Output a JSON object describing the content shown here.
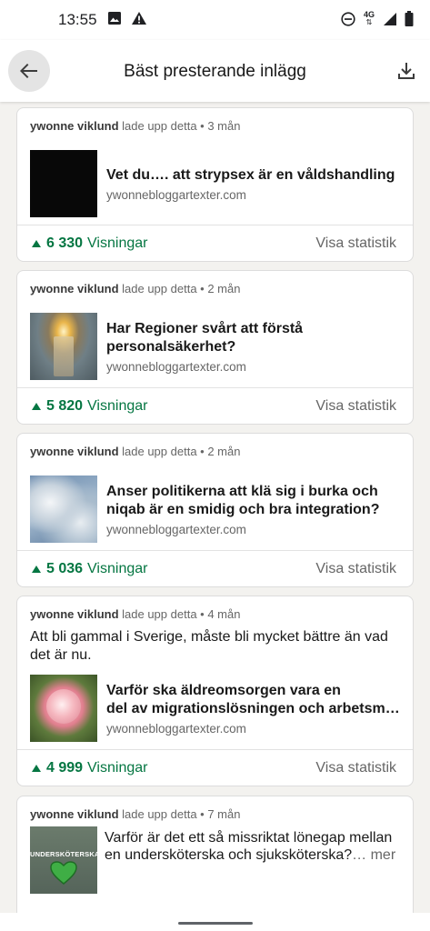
{
  "status_bar": {
    "time": "13:55",
    "network_label": "4G",
    "icons": [
      "image-icon",
      "warning-icon",
      "do-not-disturb-icon",
      "signal-icon",
      "battery-icon"
    ]
  },
  "header": {
    "title": "Bäst presterande inlägg",
    "back_icon": "arrow-back-icon",
    "download_icon": "download-icon"
  },
  "posts": [
    {
      "author": "ywonne viklund",
      "meta": "lade upp detta • 3 mån",
      "thumbnail": "black-thumbnail",
      "link_title": "Vet du…. att strypsex är en våldshandling",
      "link_domain": "ywonnebloggartexter.com",
      "views_count": "6 330",
      "views_label": "Visningar",
      "stats_label": "Visa statistik"
    },
    {
      "author": "ywonne viklund",
      "meta": "lade upp detta • 2 mån",
      "thumbnail": "candle-thumbnail",
      "link_title": "Har Regioner svårt att förstå personalsäkerhet?",
      "link_domain": "ywonnebloggartexter.com",
      "views_count": "5 820",
      "views_label": "Visningar",
      "stats_label": "Visa statistik"
    },
    {
      "author": "ywonne viklund",
      "meta": "lade upp detta • 2 mån",
      "thumbnail": "sky-thumbnail",
      "link_title": "Anser politikerna att klä sig i burka och niqab är en smidig och bra integration?",
      "link_domain": "ywonnebloggartexter.com",
      "views_count": "5 036",
      "views_label": "Visningar",
      "stats_label": "Visa statistik"
    },
    {
      "author": "ywonne viklund",
      "meta": "lade upp detta • 4 mån",
      "text": "Att bli gammal i Sverige, måste bli mycket bättre än vad det är nu.",
      "thumbnail": "rose-thumbnail",
      "link_title_line1": "Varför ska äldreomsorgen vara en",
      "link_title_line2": "del av migrationslösningen och arbetsmar...",
      "link_domain": "ywonnebloggartexter.com",
      "views_count": "4 999",
      "views_label": "Visningar",
      "stats_label": "Visa statistik"
    },
    {
      "author": "ywonne viklund",
      "meta": "lade upp detta • 7 mån",
      "thumbnail": "undersköterska-thumbnail",
      "thumbnail_text": "UNDERSKÖTERSKA",
      "text": "Varför är det ett så missriktat lönegap mellan en undersköterska och sjuksköterska?",
      "more_label": "… mer"
    }
  ],
  "colors": {
    "accent_green": "#057642",
    "background": "#f3f2ef",
    "card": "#ffffff"
  }
}
